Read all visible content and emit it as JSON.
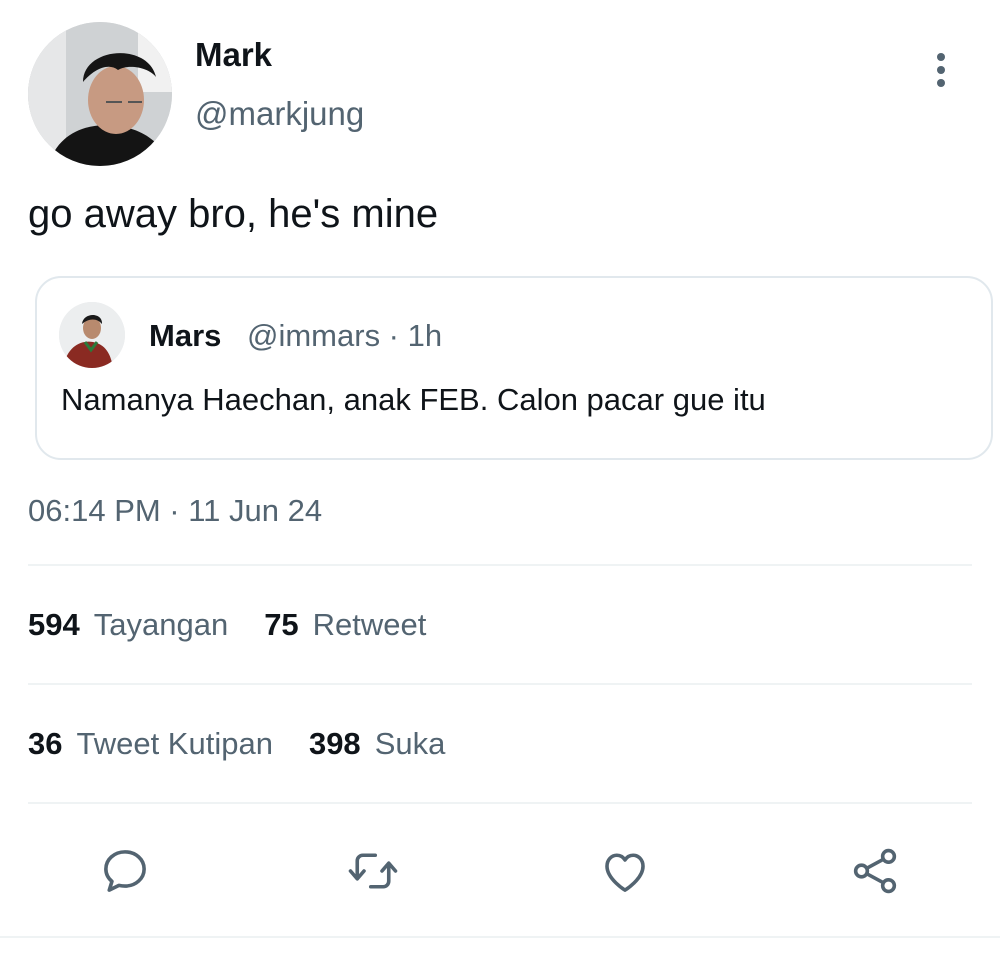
{
  "author": {
    "display_name": "Mark",
    "handle": "@markjung"
  },
  "tweet": {
    "text": "go away bro, he's mine",
    "timestamp": "06:14 PM · 11 Jun 24"
  },
  "quoted": {
    "display_name": "Mars",
    "meta": "@immars · 1h",
    "text": "Namanya Haechan, anak FEB. Calon pacar gue itu"
  },
  "stats": {
    "views": {
      "count": "594",
      "label": "Tayangan"
    },
    "retweets": {
      "count": "75",
      "label": "Retweet"
    },
    "quotes": {
      "count": "36",
      "label": "Tweet Kutipan"
    },
    "likes": {
      "count": "398",
      "label": "Suka"
    }
  },
  "icons": {
    "more": "more-vertical-icon",
    "reply": "reply-icon",
    "retweet": "retweet-icon",
    "like": "heart-icon",
    "share": "share-icon"
  },
  "colors": {
    "text_primary": "#0f1419",
    "text_secondary": "#536471",
    "border": "#e1e8ed",
    "divider": "#eff3f4"
  }
}
